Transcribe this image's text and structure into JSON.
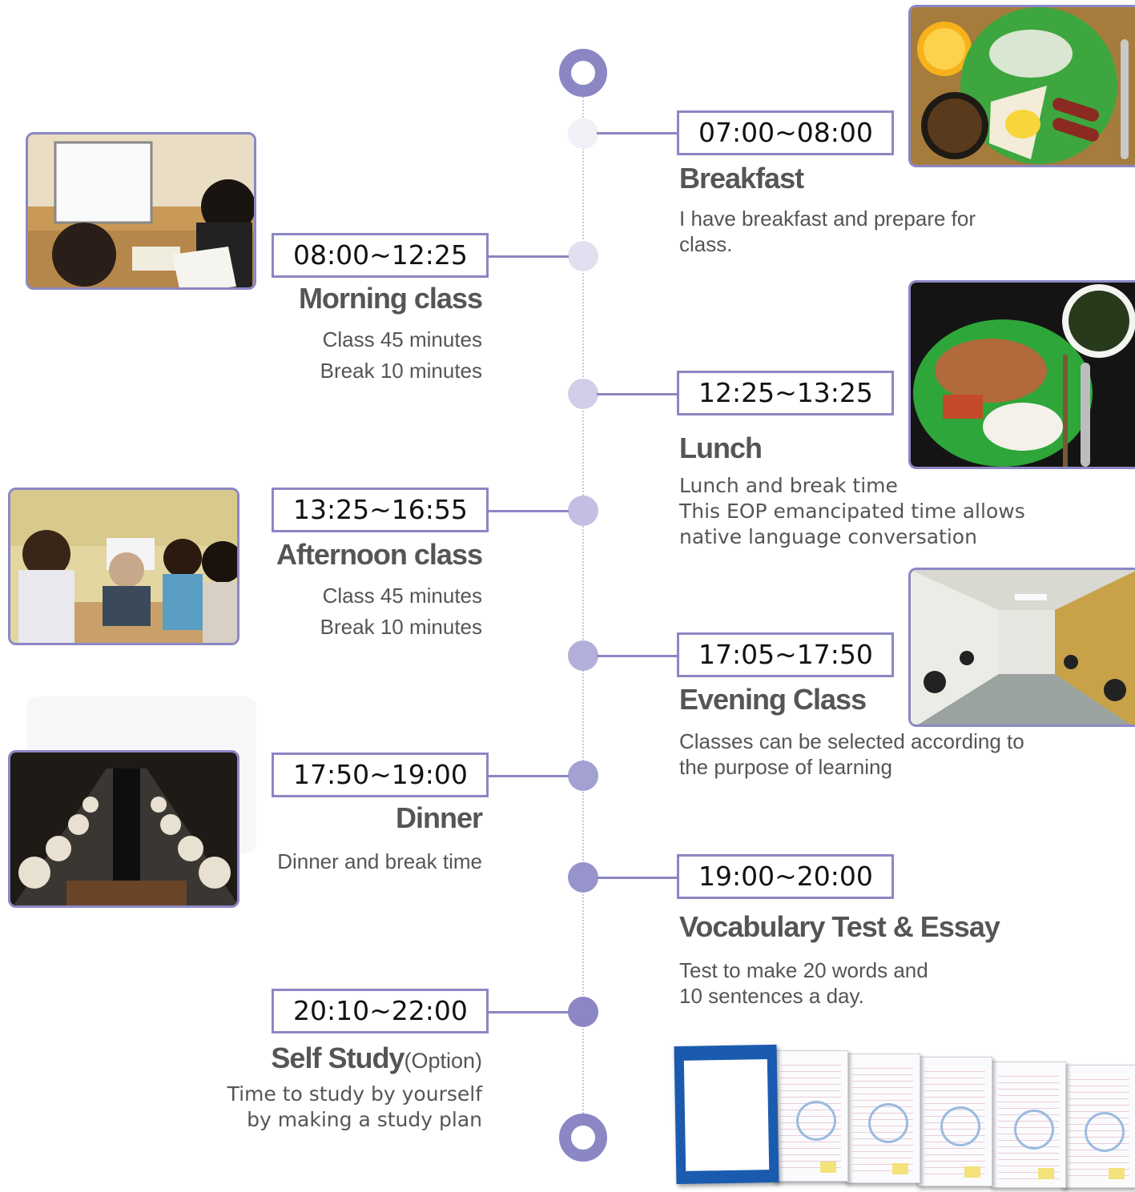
{
  "colors": {
    "accent": "#8b87c4"
  },
  "schedule": [
    {
      "time": "07:00~08:00",
      "title": "Breakfast",
      "desc": [
        "I have breakfast and prepare for",
        "class."
      ],
      "photo_icon": "breakfast-tray-photo"
    },
    {
      "time": "08:00~12:25",
      "title": "Morning class",
      "desc": [
        "Class 45 minutes",
        "Break 10 minutes"
      ],
      "photo_icon": "classroom-whiteboard-photo"
    },
    {
      "time": "12:25~13:25",
      "title": "Lunch",
      "desc": [
        "Lunch  and  break time",
        "This EOP emancipated time allows",
        "native language conversation"
      ],
      "photo_icon": "lunch-plate-photo"
    },
    {
      "time": "13:25~16:55",
      "title": "Afternoon class",
      "desc": [
        "Class 45 minutes",
        "Break 10 minutes"
      ],
      "photo_icon": "group-class-photo"
    },
    {
      "time": "17:05~17:50",
      "title": "Evening Class",
      "desc": [
        "Classes can be selected according to",
        "the purpose of learning"
      ],
      "photo_icon": "study-hall-photo"
    },
    {
      "time": "17:50~19:00",
      "title": "Dinner",
      "desc": [
        "Dinner and break time"
      ],
      "photo_icon": "dinner-buffet-photo"
    },
    {
      "time": "19:00~20:00",
      "title": "Vocabulary Test & Essay",
      "desc": [
        "Test to make 20 words and",
        "10 sentences a day."
      ],
      "photo_icon": "essay-notebook-photo"
    },
    {
      "time": "20:10~22:00",
      "title": "Self Study",
      "title_suffix": "(Option)",
      "desc": [
        "Time to study by yourself",
        "by making a study plan"
      ]
    }
  ]
}
